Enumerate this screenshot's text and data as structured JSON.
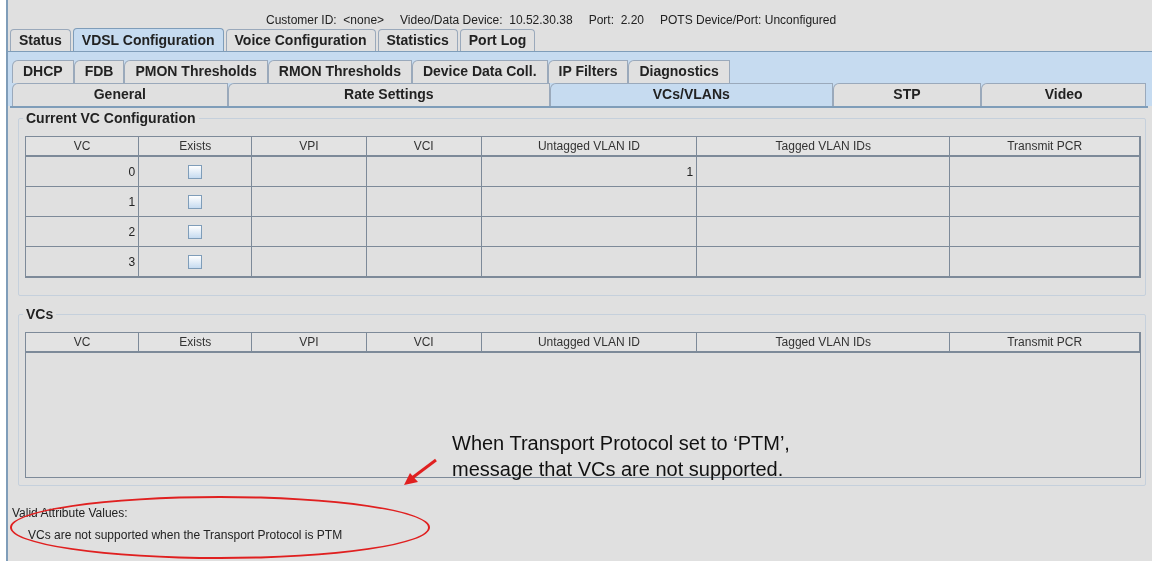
{
  "info_bar": [
    "Customer ID:  <none>",
    "Video/Data Device:  10.52.30.38",
    "Port:  2.20",
    "POTS Device/Port: Unconfigured"
  ],
  "tabs": [
    {
      "label": "Status",
      "selected": false
    },
    {
      "label": "VDSL Configuration",
      "selected": true
    },
    {
      "label": "Voice Configuration",
      "selected": false
    },
    {
      "label": "Statistics",
      "selected": false
    },
    {
      "label": "Port Log",
      "selected": false
    }
  ],
  "subtabs_row_1": [
    {
      "label": "DHCP",
      "selected": false
    },
    {
      "label": "FDB",
      "selected": false
    },
    {
      "label": "PMON Thresholds",
      "selected": false
    },
    {
      "label": "RMON Thresholds",
      "selected": false
    },
    {
      "label": "Device Data Coll.",
      "selected": false
    },
    {
      "label": "IP Filters",
      "selected": false
    },
    {
      "label": "Diagnostics",
      "selected": false
    }
  ],
  "subtabs_row_2": [
    {
      "label": "General",
      "selected": false
    },
    {
      "label": "Rate Settings",
      "selected": false
    },
    {
      "label": "VCs/VLANs",
      "selected": true
    },
    {
      "label": "STP",
      "selected": false
    },
    {
      "label": "Video",
      "selected": false
    }
  ],
  "current_vc_configuration": {
    "title": "Current VC Configuration",
    "columns": [
      "VC",
      "Exists",
      "VPI",
      "VCI",
      "Untagged VLAN ID",
      "Tagged VLAN IDs",
      "Transmit PCR"
    ],
    "rows": [
      {
        "vc": "0",
        "exists": false,
        "untagged_vlan_id": "1"
      },
      {
        "vc": "1",
        "exists": false
      },
      {
        "vc": "2",
        "exists": false
      },
      {
        "vc": "3",
        "exists": false
      }
    ]
  },
  "vcs": {
    "title": "VCs",
    "columns": [
      "VC",
      "Exists",
      "VPI",
      "VCI",
      "Untagged VLAN ID",
      "Tagged VLAN IDs",
      "Transmit PCR"
    ]
  },
  "valid_attribute_values": {
    "label": "Valid Attribute Values:",
    "message": "VCs are not supported when the Transport Protocol is PTM"
  },
  "annotation": {
    "lines": [
      "When Transport Protocol set to ‘PTM’,",
      "message that VCs are not supported."
    ]
  }
}
